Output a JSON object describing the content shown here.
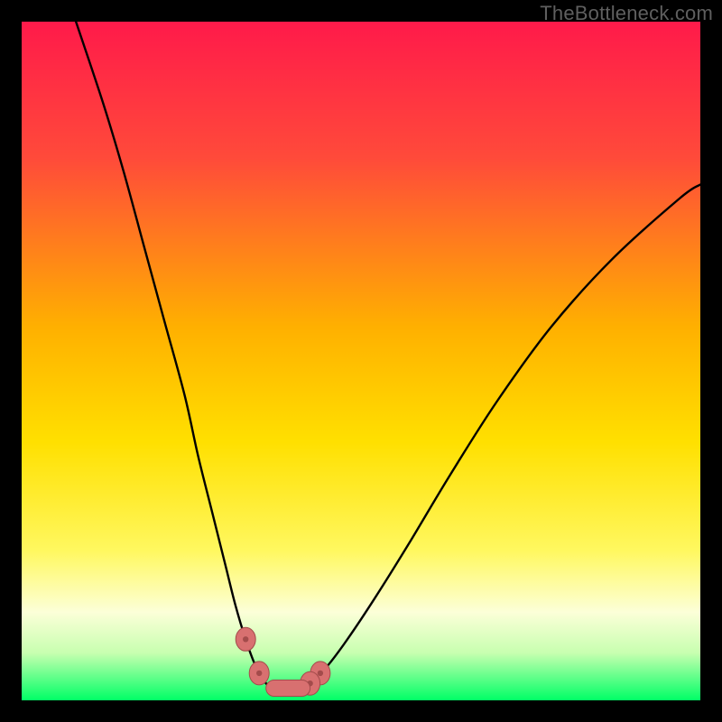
{
  "watermark": "TheBottleneck.com",
  "colors": {
    "bg": "#000000",
    "grad_top": "#ff1a4a",
    "grad_mid_upper": "#ff6a2e",
    "grad_mid": "#ffd000",
    "grad_mid_lower": "#fff24a",
    "grad_pale": "#fbffd0",
    "grad_green": "#00ff66",
    "curve": "#000000",
    "marker_fill": "#d87070",
    "marker_stroke": "#a34b4b"
  },
  "chart_data": {
    "type": "line",
    "title": "",
    "xlabel": "",
    "ylabel": "",
    "xlim": [
      0,
      100
    ],
    "ylim": [
      0,
      100
    ],
    "grid": false,
    "legend": false,
    "annotations": [
      "TheBottleneck.com"
    ],
    "series": [
      {
        "name": "left-branch",
        "x": [
          8,
          12,
          15,
          18,
          21,
          24,
          26,
          28,
          30,
          31.5,
          33,
          34.5,
          36,
          37
        ],
        "y": [
          100,
          88,
          78,
          67,
          56,
          45,
          36,
          28,
          20,
          14,
          9,
          5,
          2.5,
          2
        ]
      },
      {
        "name": "right-branch",
        "x": [
          41,
          43,
          45,
          48,
          52,
          57,
          63,
          70,
          78,
          87,
          97,
          100
        ],
        "y": [
          2,
          3,
          5,
          9,
          15,
          23,
          33,
          44,
          55,
          65,
          74,
          76
        ]
      },
      {
        "name": "floor",
        "x": [
          37,
          38.5,
          40,
          41
        ],
        "y": [
          2,
          1.8,
          1.8,
          2
        ]
      }
    ],
    "markers": [
      {
        "name": "left-dot-upper",
        "x": 33.0,
        "y": 9.0
      },
      {
        "name": "left-dot-lower",
        "x": 35.0,
        "y": 4.0
      },
      {
        "name": "right-dot-upper",
        "x": 44.0,
        "y": 4.0
      },
      {
        "name": "right-dot-lower",
        "x": 42.5,
        "y": 2.5
      },
      {
        "name": "floor-bar",
        "type": "bar",
        "x0": 36.0,
        "x1": 42.5,
        "y": 1.8
      }
    ],
    "gradient_stops": [
      {
        "offset": 0.0,
        "color": "#ff1a4a"
      },
      {
        "offset": 0.2,
        "color": "#ff4a3a"
      },
      {
        "offset": 0.45,
        "color": "#ffb000"
      },
      {
        "offset": 0.62,
        "color": "#ffe000"
      },
      {
        "offset": 0.78,
        "color": "#fff860"
      },
      {
        "offset": 0.87,
        "color": "#fcffd8"
      },
      {
        "offset": 0.93,
        "color": "#c8ffb0"
      },
      {
        "offset": 1.0,
        "color": "#00ff66"
      }
    ]
  }
}
